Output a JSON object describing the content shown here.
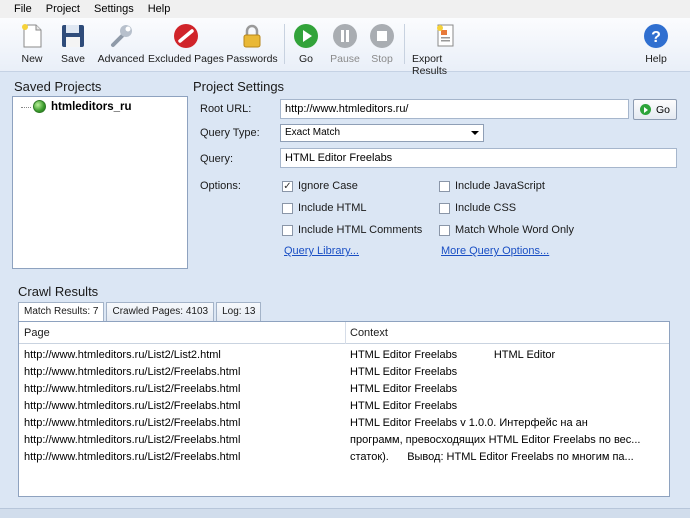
{
  "menu": [
    "File",
    "Project",
    "Settings",
    "Help"
  ],
  "toolbar": {
    "new": "New",
    "save": "Save",
    "advanced": "Advanced",
    "excluded_pages": "Excluded Pages",
    "passwords": "Passwords",
    "go": "Go",
    "pause": "Pause",
    "stop": "Stop",
    "export_results": "Export Results",
    "help": "Help"
  },
  "saved_projects": {
    "title": "Saved Projects",
    "items": [
      "htmleditors_ru"
    ]
  },
  "project_settings": {
    "title": "Project Settings",
    "root_url_label": "Root URL:",
    "root_url_value": "http://www.htmleditors.ru/",
    "go_label": "Go",
    "query_type_label": "Query Type:",
    "query_type_value": "Exact Match",
    "query_label": "Query:",
    "query_value": "HTML Editor Freelabs",
    "options_label": "Options:",
    "options": {
      "ignore_case": "Ignore Case",
      "include_html": "Include HTML",
      "include_html_comments": "Include HTML Comments",
      "include_javascript": "Include JavaScript",
      "include_css": "Include CSS",
      "match_whole_word": "Match Whole Word Only"
    },
    "checked": {
      "ignore_case": true
    },
    "query_library": "Query Library...",
    "more_query_options": "More Query Options..."
  },
  "crawl_results": {
    "title": "Crawl Results",
    "tabs": [
      "Match Results: 7",
      "Crawled Pages: 4103",
      "Log: 13"
    ],
    "columns": {
      "page": "Page",
      "context": "Context"
    },
    "rows": [
      {
        "page": "http://www.htmleditors.ru/List2/List2.html",
        "context": "HTML Editor Freelabs            HTML Editor"
      },
      {
        "page": "http://www.htmleditors.ru/List2/Freelabs.html",
        "context": "HTML Editor Freelabs"
      },
      {
        "page": "http://www.htmleditors.ru/List2/Freelabs.html",
        "context": "HTML Editor Freelabs"
      },
      {
        "page": "http://www.htmleditors.ru/List2/Freelabs.html",
        "context": "HTML Editor Freelabs"
      },
      {
        "page": "http://www.htmleditors.ru/List2/Freelabs.html",
        "context": "HTML Editor Freelabs v 1.0.0. Интерфейс на ан"
      },
      {
        "page": "http://www.htmleditors.ru/List2/Freelabs.html",
        "context": "программ, превосходящих HTML Editor Freelabs по вес..."
      },
      {
        "page": "http://www.htmleditors.ru/List2/Freelabs.html",
        "context": "статок).      Вывод: HTML Editor Freelabs по многим па..."
      }
    ]
  }
}
